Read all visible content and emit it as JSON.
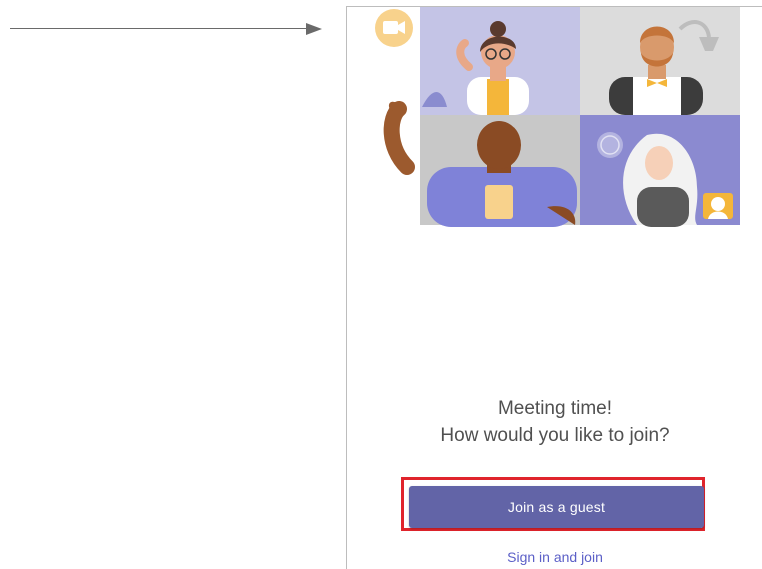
{
  "annotation": {
    "arrow_icon": "arrow-right-icon"
  },
  "illustration": {
    "video_icon": "video-camera-icon",
    "tiles": [
      "participant-woman-glasses",
      "participant-man-bowtie",
      "participant-man-waving",
      "participant-woman-white-hair"
    ]
  },
  "join": {
    "title_line1": "Meeting time!",
    "title_line2": "How would you like to join?",
    "guest_button_label": "Join as a guest",
    "signin_link_label": "Sign in and join"
  },
  "colors": {
    "brand": "#6264a7",
    "link": "#5b5fc7",
    "highlight": "#e0242c",
    "icon_badge": "#f8d28c"
  }
}
